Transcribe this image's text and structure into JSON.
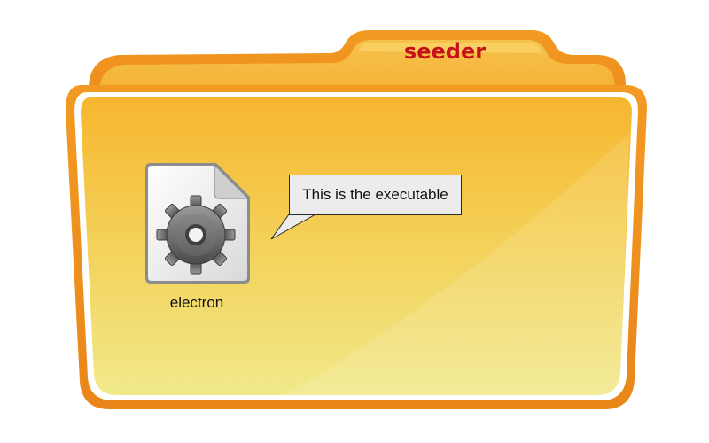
{
  "folder": {
    "title": "seeder",
    "title_color": "#c8101a",
    "body_color": "#f5c43a",
    "rim_color": "#f08a1c",
    "icon": "folder-icon"
  },
  "file": {
    "name": "electron",
    "icon": "gear-file-icon"
  },
  "callout": {
    "text": "This is the executable"
  }
}
